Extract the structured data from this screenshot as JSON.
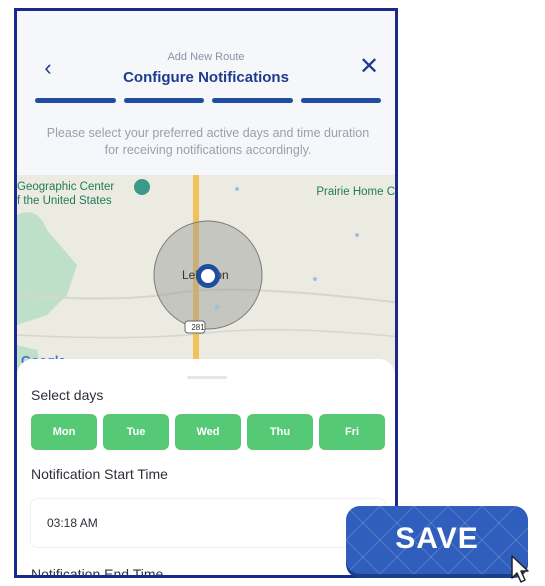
{
  "header": {
    "subtitle": "Add New Route",
    "title": "Configure Notifications",
    "back_icon": "chevron-left-icon",
    "close_icon": "close-icon",
    "progress_steps": 4
  },
  "instructions": "Please select your preferred active days and time duration for receiving notifications accordingly.",
  "map": {
    "geo_label_line1": "Geographic Center",
    "geo_label_line2": "f the United States",
    "prairie_label": "Prairie Home C",
    "city_label": "Lebanon",
    "route_badge": "281",
    "provider_logo": "Google"
  },
  "sheet": {
    "select_days_label": "Select days",
    "days": [
      "Mon",
      "Tue",
      "Wed",
      "Thu",
      "Fri"
    ],
    "start_time_label": "Notification Start Time",
    "start_time_value": "03:18 AM",
    "end_time_label": "Notification End Time"
  },
  "save_button": {
    "label": "SAVE"
  },
  "colors": {
    "accent": "#1f3b8f",
    "progress": "#1f4da1",
    "day_green": "#56c977",
    "save_blue": "#2f5ebd",
    "frame_border": "#1a2a8c"
  }
}
